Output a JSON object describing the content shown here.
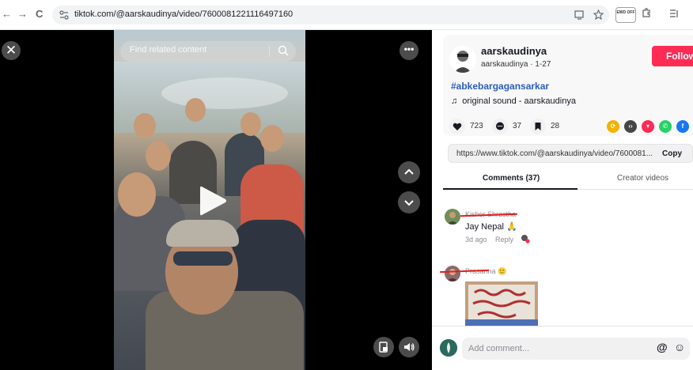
{
  "browser": {
    "nav_back": "←",
    "nav_forward": "→",
    "reload": "C",
    "url": "tiktok.com/@aarskaudinya/video/7600081221116497160",
    "ext_badge": "EWD OFF"
  },
  "video": {
    "search_placeholder": "Find related content",
    "close_icon": "close-icon",
    "more_icon": "more-icon",
    "play_icon": "play-icon"
  },
  "author": {
    "username": "aarskaudinya",
    "handle": "aarskaudinya",
    "date": "1-27",
    "follow_label": "Follow",
    "hashtag": "#abkebargagansarkar",
    "sound": "original sound - aarskaudinya"
  },
  "stats": {
    "likes": "723",
    "comments": "37",
    "saves": "28"
  },
  "share": {
    "link": "https://www.tiktok.com/@aarskaudinya/video/7600081...",
    "copy_label": "Copy",
    "colors": [
      "#f2b200",
      "#454545",
      "#fe2c55",
      "#25d366",
      "#1877f2"
    ]
  },
  "tabs": {
    "comments": "Comments (37)",
    "creator": "Creator videos"
  },
  "comments": [
    {
      "user": "Kishor Shrestha",
      "text": "Jay Nepal 🙏",
      "time": "3d ago",
      "reply": "Reply"
    },
    {
      "user": "Prasanna 🙂"
    }
  ],
  "add_comment": {
    "placeholder": "Add comment...",
    "at": "@",
    "emoji": "☺"
  }
}
